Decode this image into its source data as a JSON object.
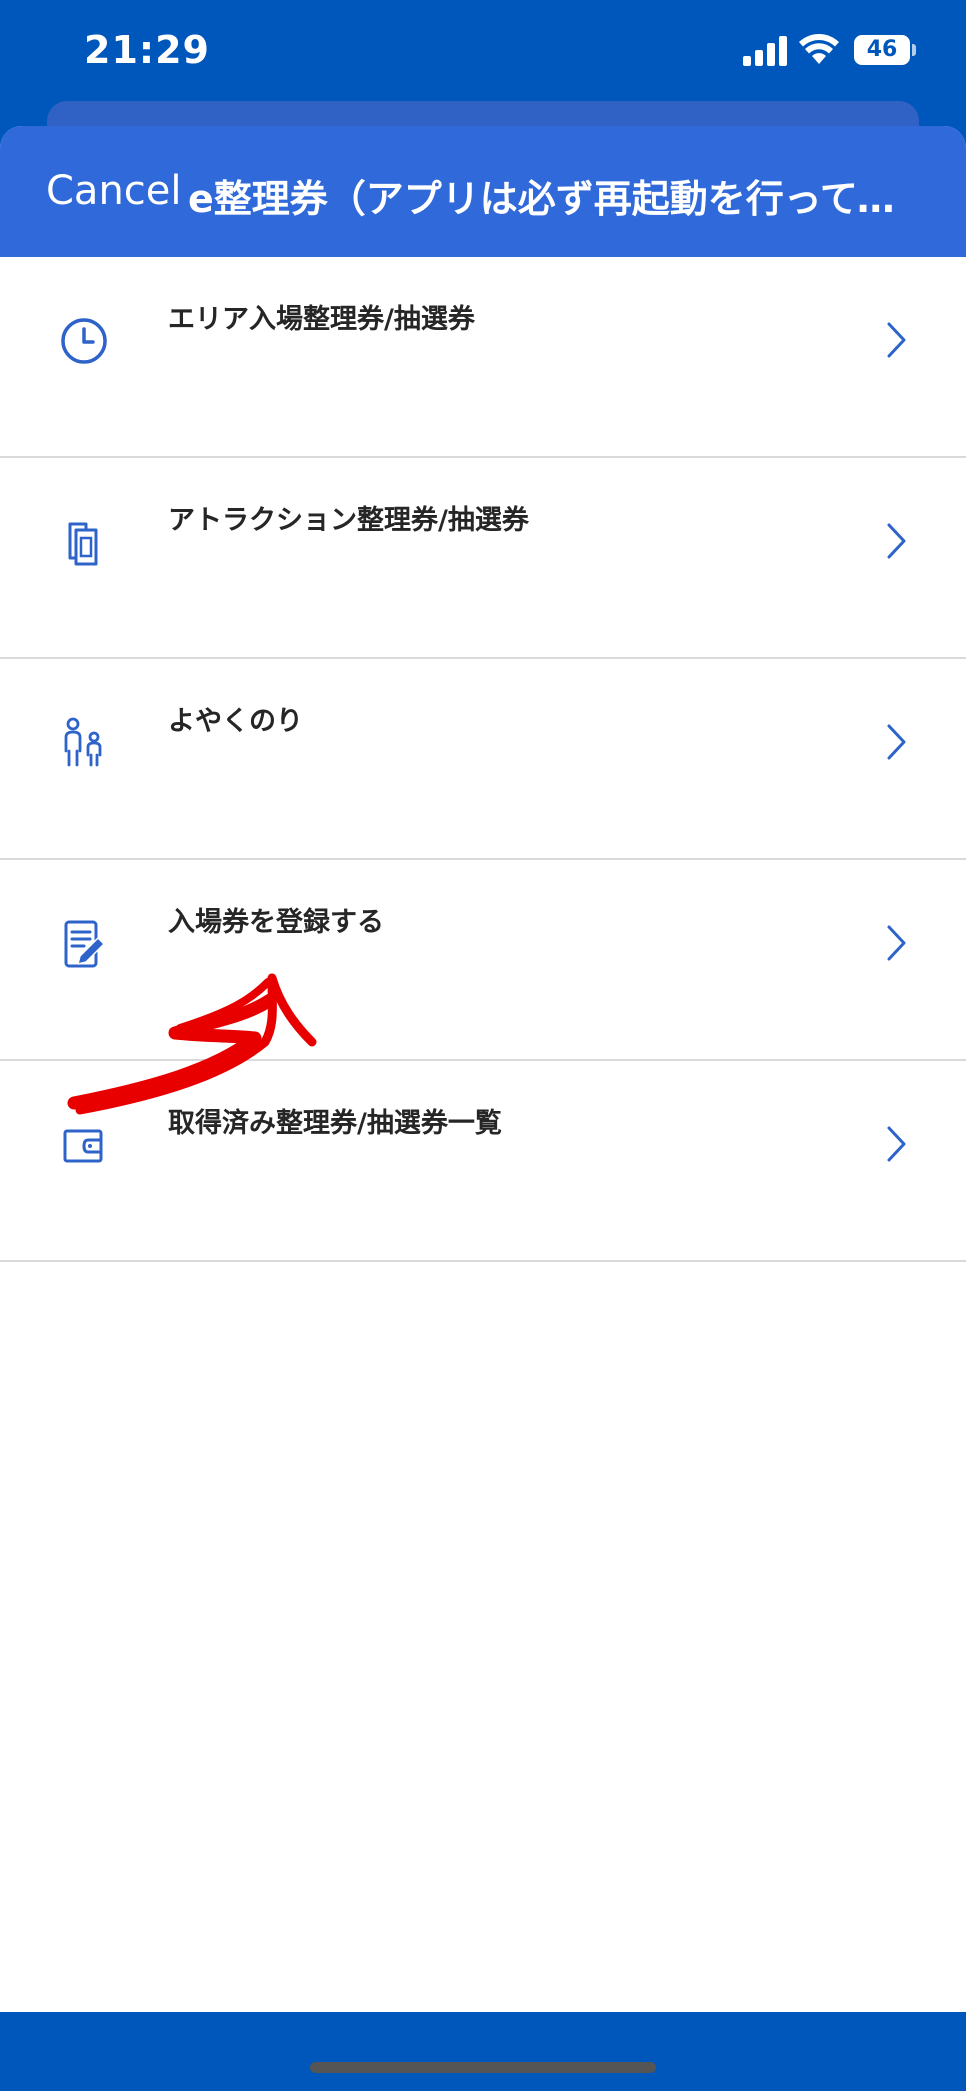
{
  "status_bar": {
    "time": "21:29",
    "battery": "46",
    "signal_icon": "cellular-signal-icon",
    "wifi_icon": "wifi-icon"
  },
  "nav": {
    "cancel_label": "Cancel",
    "title": "e整理券（アプリは必ず再起動を行ってください）"
  },
  "menu": {
    "items": [
      {
        "label": "エリア入場整理券/抽選券",
        "icon": "clock-icon"
      },
      {
        "label": "アトラクション整理券/抽選券",
        "icon": "tickets-icon"
      },
      {
        "label": "よやくのり",
        "icon": "family-icon"
      },
      {
        "label": "入場券を登録する",
        "icon": "edit-document-icon"
      },
      {
        "label": "取得済み整理券/抽選券一覧",
        "icon": "wallet-icon"
      }
    ]
  },
  "colors": {
    "brand": "#0057bb",
    "nav_bar": "#3069d9",
    "icon": "#2e63c9",
    "annotation": "#e80000"
  }
}
